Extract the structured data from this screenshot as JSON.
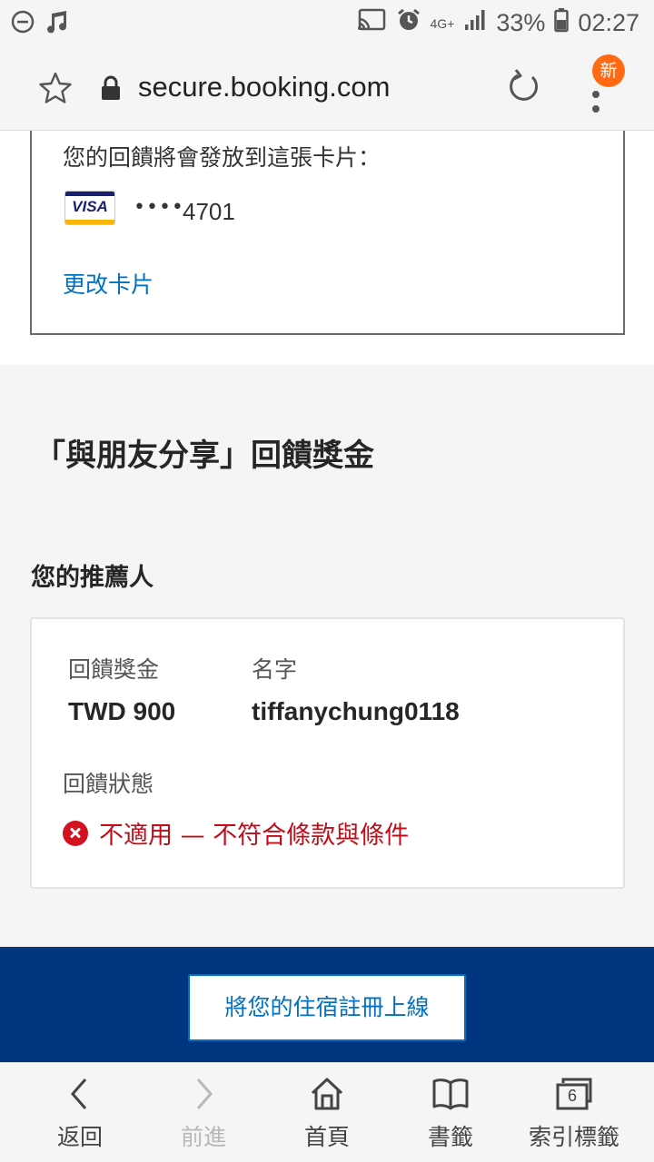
{
  "status_bar": {
    "signal_label": "4G+",
    "battery_percent": "33%",
    "time": "02:27"
  },
  "browser": {
    "url": "secure.booking.com",
    "new_badge": "新"
  },
  "card_section": {
    "heading": "您的回饋將會發放到這張卡片：",
    "card_brand": "VISA",
    "masked_dots": "••••",
    "last_four": "4701",
    "change_card_link": "更改卡片"
  },
  "referral": {
    "section_title": "「與朋友分享」回饋獎金",
    "referrer_title": "您的推薦人",
    "reward_label": "回饋獎金",
    "reward_value": "TWD 900",
    "name_label": "名字",
    "name_value": "tiffanychung0118",
    "status_label": "回饋狀態",
    "status_value": "不適用 — 不符合條款與條件",
    "status_color": "#c00d1a"
  },
  "cta": {
    "list_property_button": "將您的住宿註冊上線"
  },
  "bottom_nav": {
    "back": "返回",
    "forward": "前進",
    "home": "首頁",
    "bookmarks": "書籤",
    "tabs": "索引標籤",
    "tab_count": "6"
  },
  "colors": {
    "brand_blue": "#003580",
    "link_blue": "#0071c2",
    "badge_orange": "#ff6a13",
    "error_red": "#d4111e"
  }
}
